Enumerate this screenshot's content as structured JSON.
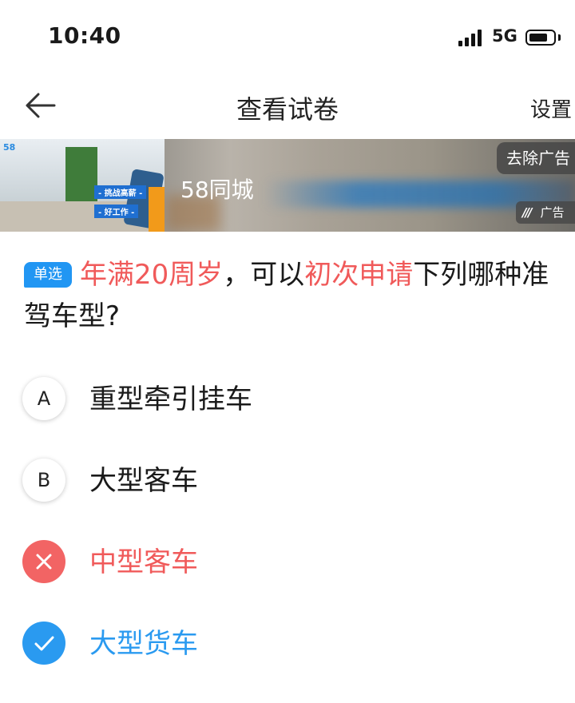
{
  "status_bar": {
    "time": "10:40",
    "network": "5G",
    "icons": [
      "signal-icon",
      "battery-icon"
    ]
  },
  "nav": {
    "title": "查看试卷",
    "settings": "设置",
    "back_icon": "arrow-left-icon"
  },
  "ad": {
    "brand": "58同城",
    "remove_label": "去除广告",
    "tag_label": "广告",
    "image_texts": {
      "logo": "58",
      "badge1": "- 挑战高薪 -",
      "badge2": "- 好工作 -"
    }
  },
  "question": {
    "type_badge": "单选",
    "parts": [
      "年满20周岁",
      "，可以",
      "初次申请",
      "下列哪种准驾车型?"
    ],
    "highlight_color": "#f05a5a"
  },
  "options": [
    {
      "marker": "A",
      "text": "重型牵引挂车",
      "state": "normal"
    },
    {
      "marker": "B",
      "text": "大型客车",
      "state": "normal"
    },
    {
      "marker": "",
      "text": "中型客车",
      "state": "wrong",
      "icon": "close-icon"
    },
    {
      "marker": "",
      "text": "大型货车",
      "state": "correct",
      "icon": "check-icon"
    }
  ],
  "colors": {
    "accent_blue": "#2a9af0",
    "wrong_red": "#f26464"
  }
}
